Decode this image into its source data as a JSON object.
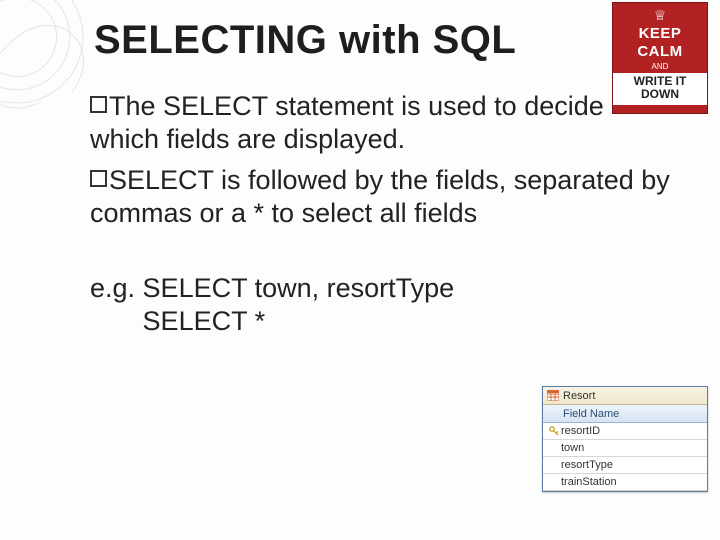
{
  "title": "SELECTING with SQL",
  "poster": {
    "line1": "KEEP",
    "line2": "CALM",
    "and": "AND",
    "line3": "WRITE IT",
    "line4": "DOWN"
  },
  "bullets": [
    "The SELECT statement is used to decide which fields are displayed.",
    "SELECT is followed by the fields, separated by commas or a * to select all fields"
  ],
  "example": {
    "prefix": "e.g. ",
    "line1": "SELECT town, resortType",
    "line2": "SELECT *"
  },
  "table": {
    "tab_label": "Resort",
    "header": "Field Name",
    "rows": [
      {
        "name": "resortID",
        "pk": true
      },
      {
        "name": "town",
        "pk": false
      },
      {
        "name": "resortType",
        "pk": false
      },
      {
        "name": "trainStation",
        "pk": false
      }
    ]
  }
}
